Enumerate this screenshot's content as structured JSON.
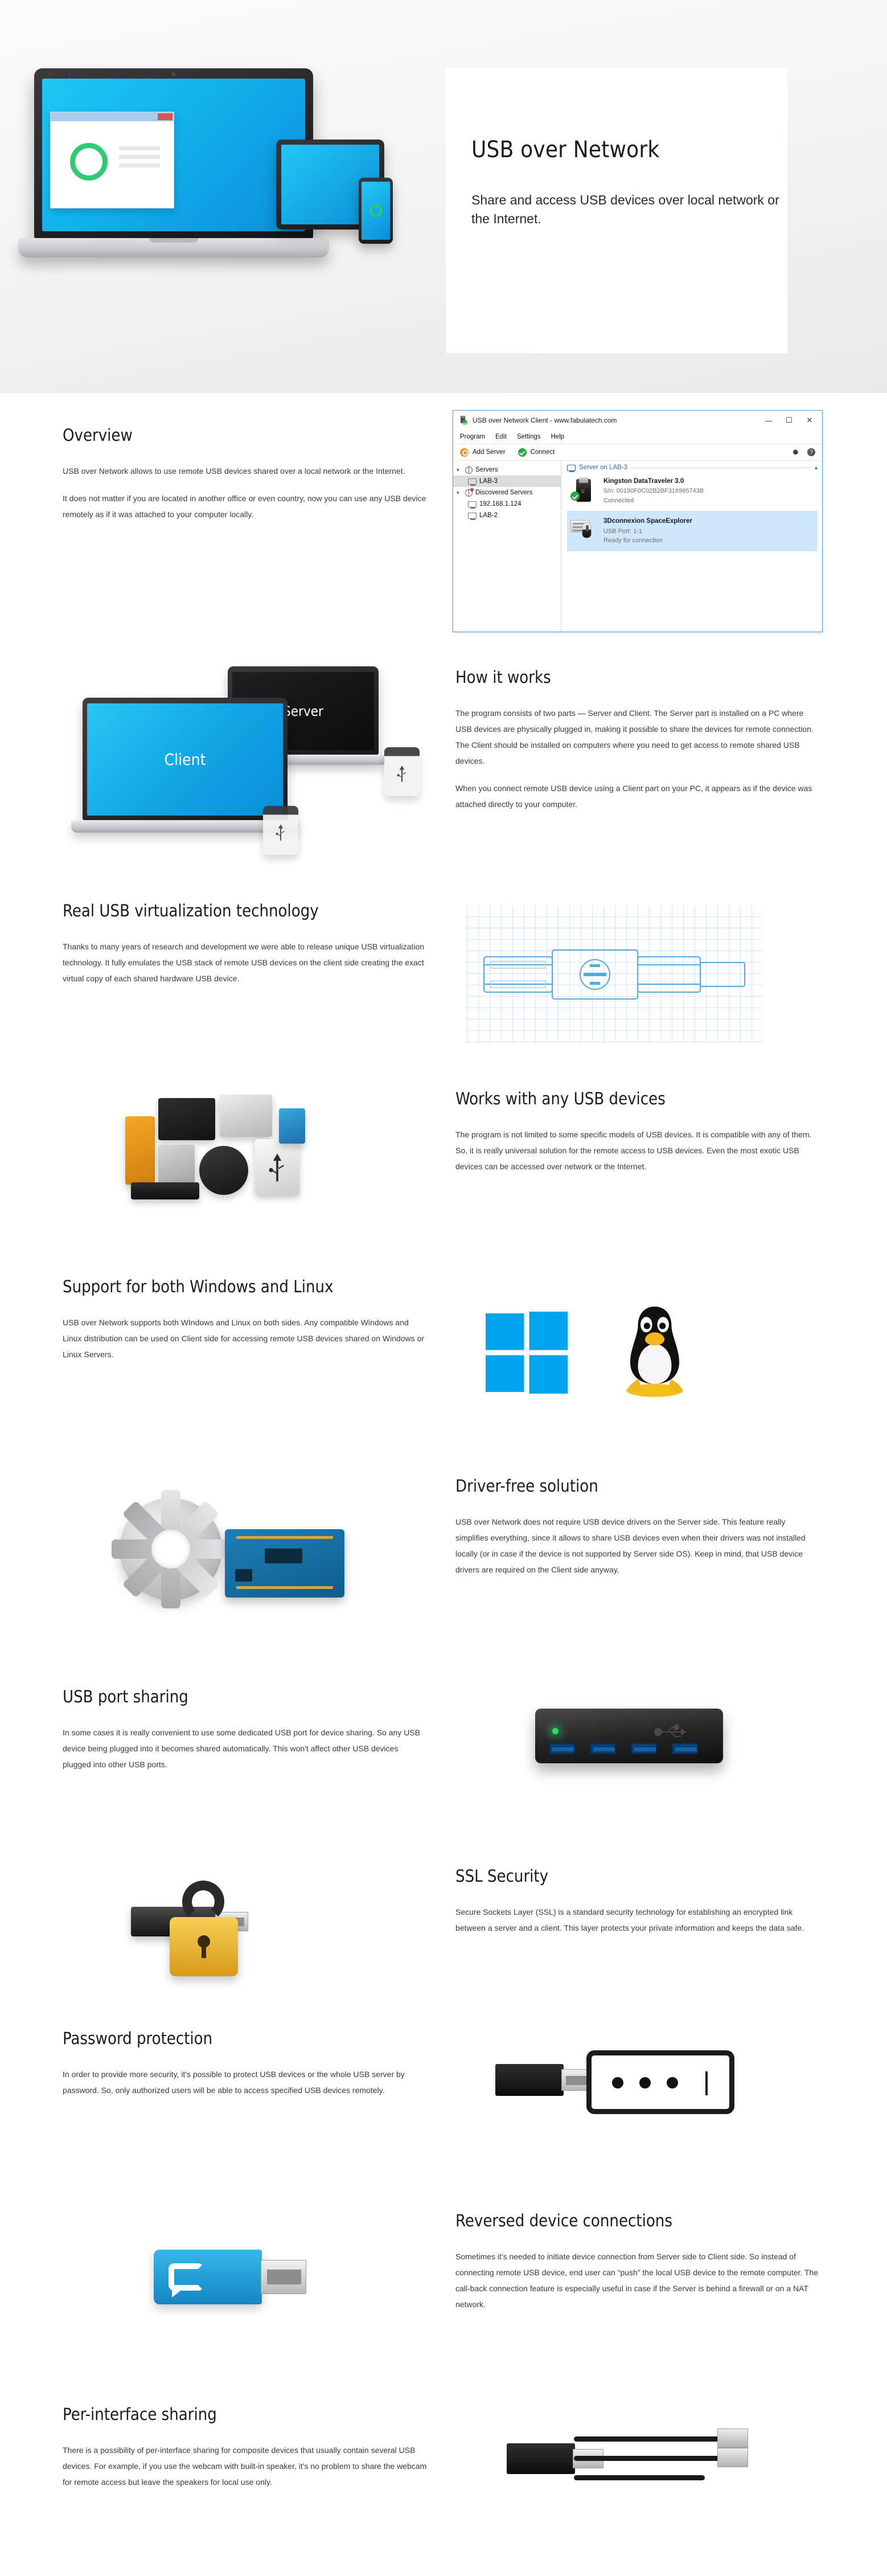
{
  "hero": {
    "title": "USB over Network",
    "subtitle": "Share and access USB devices over local network or the Internet."
  },
  "app_window": {
    "title": "USB over Network Client - www.fabulatech.com",
    "icon": "usb-flash-check-icon",
    "window_buttons": {
      "minimize": "—",
      "maximize": "☐",
      "close": "✕"
    },
    "menu": [
      "Program",
      "Edit",
      "Settings",
      "Help"
    ],
    "toolbar": {
      "add_server": "Add Server",
      "connect": "Connect",
      "settings_icon": "gear-icon",
      "help_icon": "question-mark-icon"
    },
    "tree": [
      {
        "label": "Servers",
        "icon": "globe-icon",
        "level": 0,
        "expanded": true,
        "selected": false
      },
      {
        "label": "LAB-3",
        "icon": "monitor-icon",
        "level": 1,
        "expanded": false,
        "selected": true
      },
      {
        "label": "Discovered Servers",
        "icon": "globe-alert-icon",
        "level": 0,
        "expanded": true,
        "selected": false
      },
      {
        "label": "192.168.1.124",
        "icon": "monitor-icon",
        "level": 1,
        "expanded": false,
        "selected": false
      },
      {
        "label": "LAB-2",
        "icon": "monitor-icon",
        "level": 1,
        "expanded": false,
        "selected": false
      }
    ],
    "group_header": "Server on LAB-3",
    "devices": [
      {
        "name": "Kingston DataTraveler 3.0",
        "detail_label": "S/n:",
        "detail_value": "00190F0C02B2BF316965743B",
        "status": "Connected",
        "icon": "usb-flash-drive-icon",
        "highlighted": false
      },
      {
        "name": "3Dconnexion SpaceExplorer",
        "detail_label": "USB Port:",
        "detail_value": "1-1",
        "status": "Ready for connection",
        "icon": "keyboard-mouse-icon",
        "highlighted": true
      }
    ]
  },
  "sections": [
    {
      "id": "overview",
      "heading": "Overview",
      "paragraphs": [
        "USB over Network allows to use remote USB devices shared over a local network or the Internet.",
        "It does not matter if you are located in another office or even country, now you can use any USB device remotely as if it was attached to your computer locally."
      ]
    },
    {
      "id": "how-it-works",
      "heading": "How it works",
      "paragraphs": [
        "The program consists of two parts — Server and Client. The Server part is installed on a PC where USB devices are physically plugged in, making it possible to share the devices for remote connection. The Client should be installed on computers where you need to get access to remote shared USB devices.",
        "When you connect remote USB device using a Client part on your PC, it appears as if the device was attached directly to your computer."
      ],
      "art": {
        "client_label": "Client",
        "server_label": "Server"
      }
    },
    {
      "id": "real-usb-virtualization",
      "heading": "Real USB virtualization technology",
      "paragraphs": [
        "Thanks to many years of research and development we were able to release unique USB virtualization technology. It fully emulates the USB stack of remote USB devices on the client side creating the exact virtual copy of each shared hardware USB device."
      ]
    },
    {
      "id": "works-with-any-usb-devices",
      "heading": "Works with any USB devices",
      "paragraphs": [
        "The program is not limited to some specific models of USB devices. It is compatible with any of them. So, it is really universal solution for the remote access to USB devices. Even the most exotic USB devices can be accessed over network or the Internet."
      ]
    },
    {
      "id": "support-windows-linux",
      "heading": "Support for both Windows and Linux",
      "paragraphs": [
        "USB over Network supports both WIndows and Linux on both sides. Any compatible Windows and Linux distribution can be used on Client side for accessing remote USB devices shared on Windows or Linux Servers."
      ]
    },
    {
      "id": "driver-free-solution",
      "heading": "Driver-free solution",
      "paragraphs": [
        "USB over Network does not require USB device drivers on the Server side. This feature really simplifies everything, since it allows to share USB devices even when their drivers was not installed locally (or in case if the device is not supported by Server side OS). Keep in mind, that USB device drivers are required on the Client side anyway."
      ]
    },
    {
      "id": "usb-port-sharing",
      "heading": "USB port sharing",
      "paragraphs": [
        "In some cases it is really convenient to use some dedicated USB port for device sharing. So any USB device being plugged into it becomes shared automatically. This won't affect other USB devices plugged into other USB ports."
      ]
    },
    {
      "id": "ssl-security",
      "heading": "SSL Security",
      "paragraphs": [
        "Secure Sockets Layer (SSL) is a standard security technology for establishing an encrypted link between a server and a client. This layer protects your private information and keeps the data safe."
      ]
    },
    {
      "id": "password-protection",
      "heading": "Password protection",
      "paragraphs": [
        "In order to provide more security, it's possible to protect USB devices or the whole USB server by password. So, only authorized users will be able to access specified USB devices remotely."
      ]
    },
    {
      "id": "reversed-device-connections",
      "heading": "Reversed device connections",
      "paragraphs": [
        "Sometimes it's needed to initiate device connection from Server side to Client side. So instead of connecting remote USB device, end user can “push” the local USB device to the remote computer. The call-back connection feature is especially useful in case if the Server is behind a firewall or on a NAT network."
      ]
    },
    {
      "id": "per-interface-sharing",
      "heading": "Per-interface sharing",
      "paragraphs": [
        "There is a possibility of per-interface sharing for composite devices that usually contain several USB devices. For example, if you use the webcam with built-in speaker, it's no problem to share the webcam for remote access but leave the speakers for local use only."
      ]
    }
  ],
  "colors": {
    "accent_blue": "#00a4ef",
    "link_blue": "#2d6ab5",
    "green": "#27a744",
    "orange": "#f0921e",
    "highlight": "#cfe7fa"
  }
}
